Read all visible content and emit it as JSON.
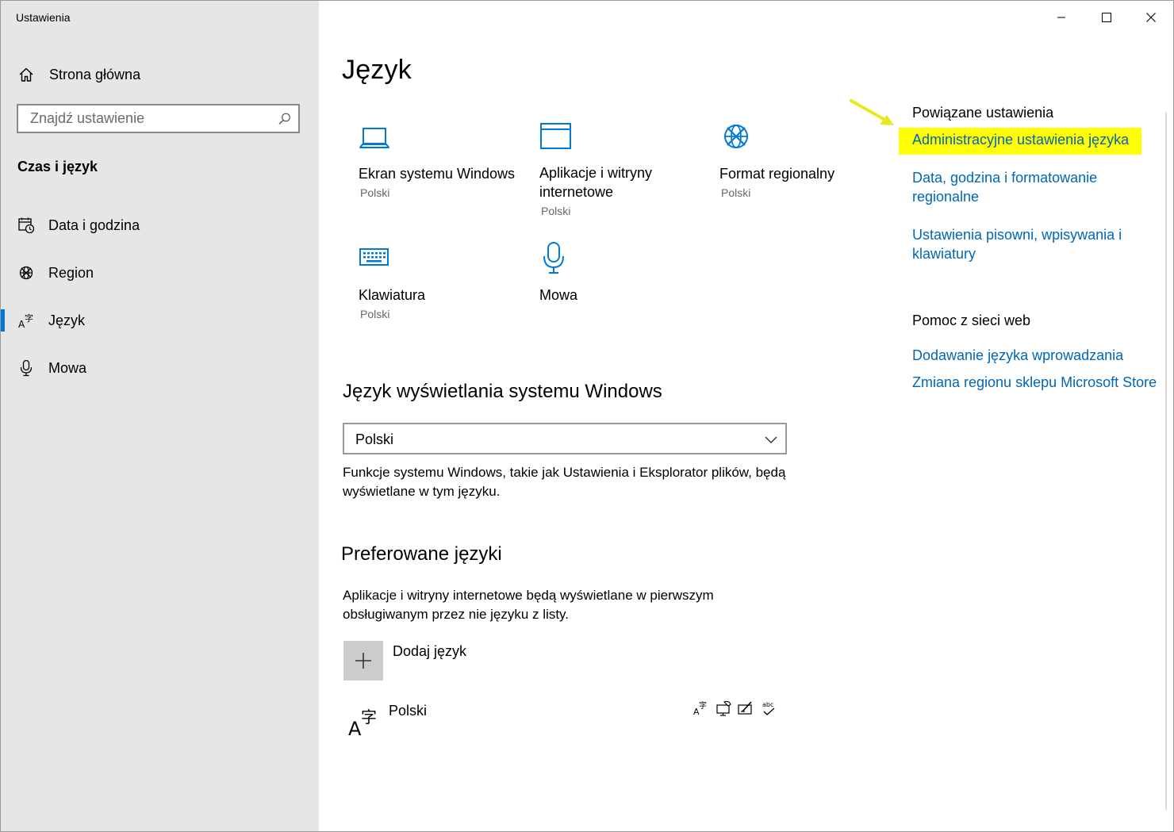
{
  "window": {
    "title": "Ustawienia"
  },
  "sidebar": {
    "home_label": "Strona główna",
    "search_placeholder": "Znajdź ustawienie",
    "section_title": "Czas i język",
    "items": [
      {
        "label": "Data i godzina",
        "icon": "calendar-clock-icon",
        "selected": false
      },
      {
        "label": "Region",
        "icon": "globe-icon",
        "selected": false
      },
      {
        "label": "Język",
        "icon": "language-icon",
        "selected": true
      },
      {
        "label": "Mowa",
        "icon": "microphone-icon",
        "selected": false
      }
    ]
  },
  "main": {
    "title": "Język",
    "tiles": [
      {
        "label": "Ekran systemu Windows",
        "sub": "Polski",
        "icon": "laptop-icon"
      },
      {
        "label": "Aplikacje i witryny internetowe",
        "sub": "Polski",
        "icon": "window-icon"
      },
      {
        "label": "Format regionalny",
        "sub": "Polski",
        "icon": "globe-icon"
      },
      {
        "label": "Klawiatura",
        "sub": "Polski",
        "icon": "keyboard-icon"
      },
      {
        "label": "Mowa",
        "sub": "",
        "icon": "microphone-icon"
      }
    ],
    "display_language": {
      "heading": "Język wyświetlania systemu Windows",
      "selected": "Polski",
      "description": "Funkcje systemu Windows, takie jak Ustawienia i Eksplorator plików, będą wyświetlane w tym języku."
    },
    "preferred": {
      "heading": "Preferowane języki",
      "description": "Aplikacje i witryny internetowe będą wyświetlane w pierwszym obsługiwanym przez nie języku z listy.",
      "add_label": "Dodaj język",
      "languages": [
        {
          "name": "Polski",
          "features": [
            "display-language-icon",
            "speech-icon",
            "handwriting-icon",
            "spelling-icon"
          ]
        }
      ]
    }
  },
  "related": {
    "heading": "Powiązane ustawienia",
    "links": [
      "Administracyjne ustawienia języka",
      "Data, godzina i formatowanie regionalne",
      "Ustawienia pisowni, wpisywania i klawiatury"
    ],
    "help_heading": "Pomoc z sieci web",
    "help_links": [
      "Dodawanie języka wprowadzania",
      "Zmiana regionu sklepu Microsoft Store"
    ]
  },
  "colors": {
    "accent": "#0078d7",
    "link": "#0067b8",
    "highlight": "#ffff00",
    "arrow": "#e8e820",
    "sidebar_bg": "#e6e6e6"
  }
}
